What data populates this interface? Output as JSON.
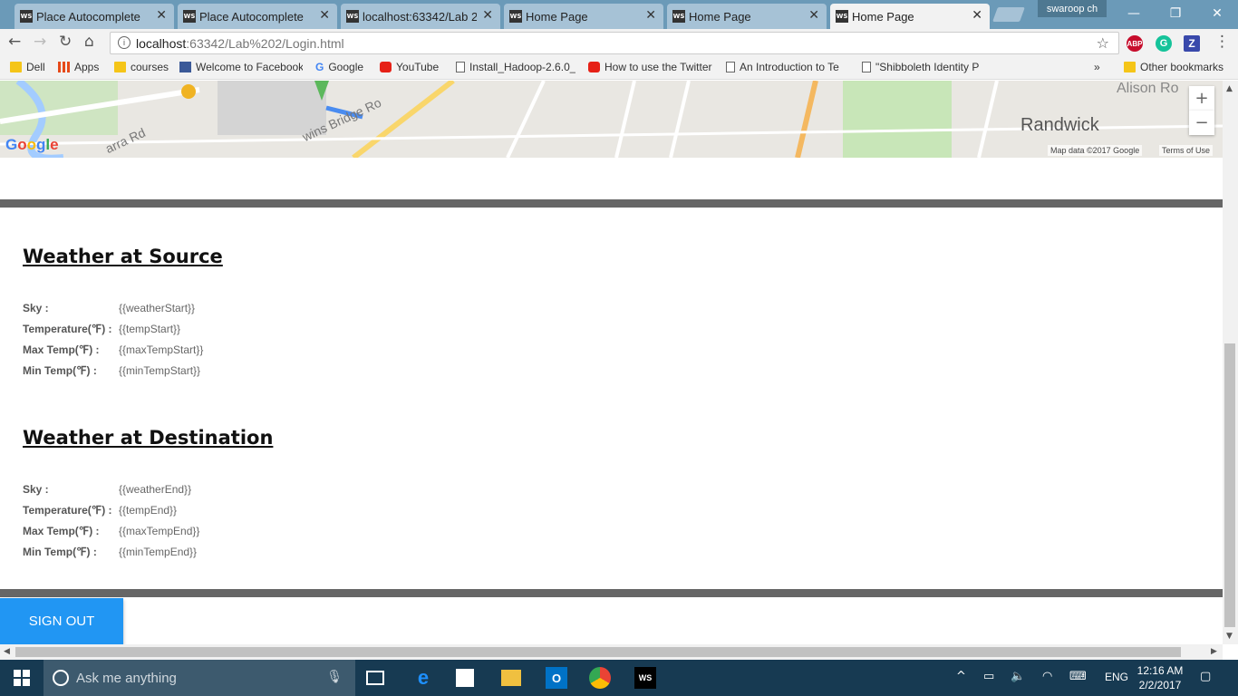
{
  "browser": {
    "tabs": [
      {
        "label": "Place Autocomplete",
        "active": false
      },
      {
        "label": "Place Autocomplete",
        "active": false
      },
      {
        "label": "localhost:63342/Lab 2/",
        "active": false
      },
      {
        "label": "Home Page",
        "active": false
      },
      {
        "label": "Home Page",
        "active": false
      },
      {
        "label": "Home Page",
        "active": true
      }
    ],
    "user": "swaroop ch",
    "address": {
      "host": "localhost",
      "path": ":63342/Lab%202/Login.html"
    },
    "extensions": [
      {
        "name": "adblock-icon",
        "label": "ABP",
        "color": "#c70d2c"
      },
      {
        "name": "grammarly-icon",
        "label": "G",
        "color": "#15c39a"
      },
      {
        "name": "z-extension-icon",
        "label": "Z",
        "color": "#3949ab"
      }
    ]
  },
  "bookmarks": {
    "items": [
      {
        "label": "Dell",
        "icon": "folder-icon"
      },
      {
        "label": "Apps",
        "icon": "apps-icon"
      },
      {
        "label": "courses",
        "icon": "folder-icon"
      },
      {
        "label": "Welcome to Facebook",
        "icon": "facebook-icon"
      },
      {
        "label": "Google",
        "icon": "google-icon"
      },
      {
        "label": "YouTube",
        "icon": "youtube-icon"
      },
      {
        "label": "Install_Hadoop-2.6.0_",
        "icon": "page-icon"
      },
      {
        "label": "How to use the Twitter",
        "icon": "youtube-icon"
      },
      {
        "label": "An Introduction to Te",
        "icon": "page-icon"
      },
      {
        "label": "\"Shibboleth Identity P",
        "icon": "page-icon"
      }
    ],
    "more": "»",
    "other": "Other bookmarks"
  },
  "map": {
    "place_labels": [
      "Randwick",
      "Alison Ro",
      "arra Rd",
      "wins Bridge Ro"
    ],
    "logo": "Google",
    "credit": "Map data ©2017 Google",
    "terms": "Terms of Use",
    "zoom_in": "+",
    "zoom_out": "−"
  },
  "source": {
    "title": "Weather at Source",
    "rows": [
      {
        "label": "Sky :",
        "value": "{{weatherStart}}"
      },
      {
        "label": "Temperature(℉) :",
        "value": "{{tempStart}}"
      },
      {
        "label": "Max Temp(℉) :",
        "value": "{{maxTempStart}}"
      },
      {
        "label": "Min Temp(℉) :",
        "value": "{{minTempStart}}"
      }
    ]
  },
  "destination": {
    "title": "Weather at Destination",
    "rows": [
      {
        "label": "Sky :",
        "value": "{{weatherEnd}}"
      },
      {
        "label": "Temperature(℉) :",
        "value": "{{tempEnd}}"
      },
      {
        "label": "Max Temp(℉) :",
        "value": "{{maxTempEnd}}"
      },
      {
        "label": "Min Temp(℉) :",
        "value": "{{minTempEnd}}"
      }
    ]
  },
  "signout_label": "SIGN OUT",
  "taskbar": {
    "search_placeholder": "Ask me anything",
    "language": "ENG",
    "time": "12:16 AM",
    "date": "2/2/2017"
  }
}
